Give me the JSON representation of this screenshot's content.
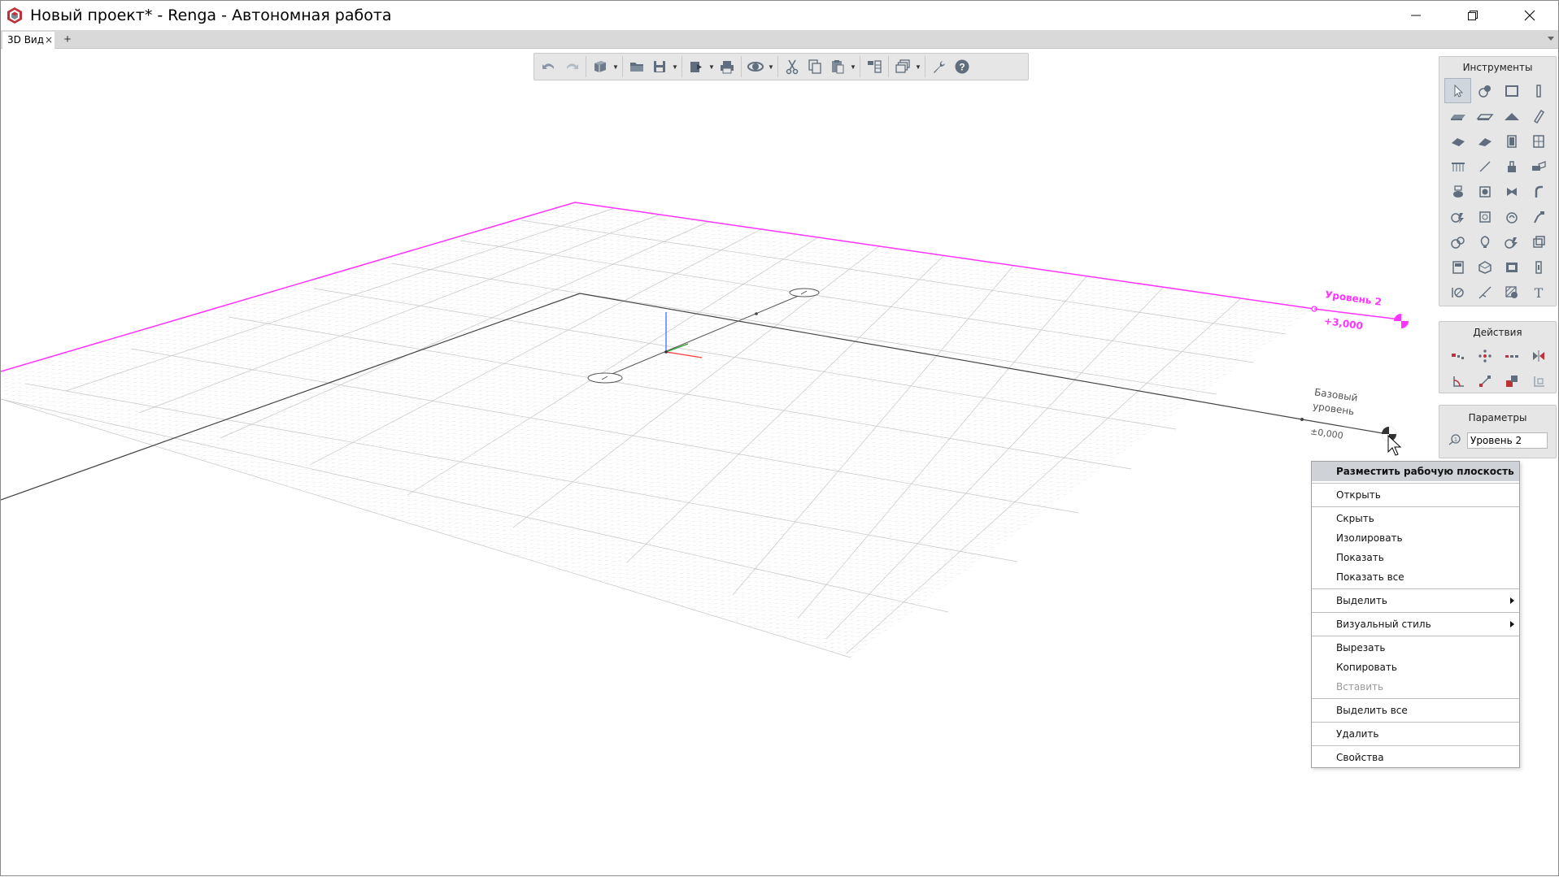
{
  "app": {
    "title": "Новый проект* - Renga - Автономная работа"
  },
  "window_controls": {
    "minimize_icon": "minimize-icon",
    "restore_icon": "restore-icon",
    "close_icon": "close-icon"
  },
  "tabs": [
    {
      "label": "3D Вид",
      "close": "×"
    }
  ],
  "tab_add": "+",
  "toolbar": {
    "buttons": [
      "undo-icon",
      "redo-icon",
      "view-cube-icon",
      "open-folder-icon",
      "save-icon",
      "export-icon",
      "print-icon",
      "orbit-icon",
      "cut-icon",
      "copy-icon",
      "paste-icon",
      "level-icon",
      "layers-icon",
      "settings-wrench-icon",
      "help-icon"
    ]
  },
  "panels": {
    "tools": {
      "title": "Инструменты"
    },
    "actions": {
      "title": "Действия"
    },
    "params": {
      "title": "Параметры",
      "field_value": "Уровень 2"
    }
  },
  "viewport": {
    "level2_name": "Уровень 2",
    "level2_elevation": "+3,000",
    "base_level_line1": "Базовый",
    "base_level_line2": "уровень",
    "base_level_elevation": "±0,000",
    "level_color": "#ff33ff"
  },
  "context_menu": {
    "items": [
      {
        "label": "Разместить рабочую плоскость",
        "highlight": true
      },
      {
        "label": "Открыть"
      },
      {
        "label": "Скрыть"
      },
      {
        "label": "Изолировать"
      },
      {
        "label": "Показать"
      },
      {
        "label": "Показать все"
      },
      {
        "label": "Выделить",
        "submenu": true
      },
      {
        "label": "Визуальный стиль",
        "submenu": true
      },
      {
        "label": "Вырезать"
      },
      {
        "label": "Копировать"
      },
      {
        "label": "Вставить",
        "disabled": true
      },
      {
        "label": "Выделить все"
      },
      {
        "label": "Удалить"
      },
      {
        "label": "Свойства"
      }
    ]
  }
}
